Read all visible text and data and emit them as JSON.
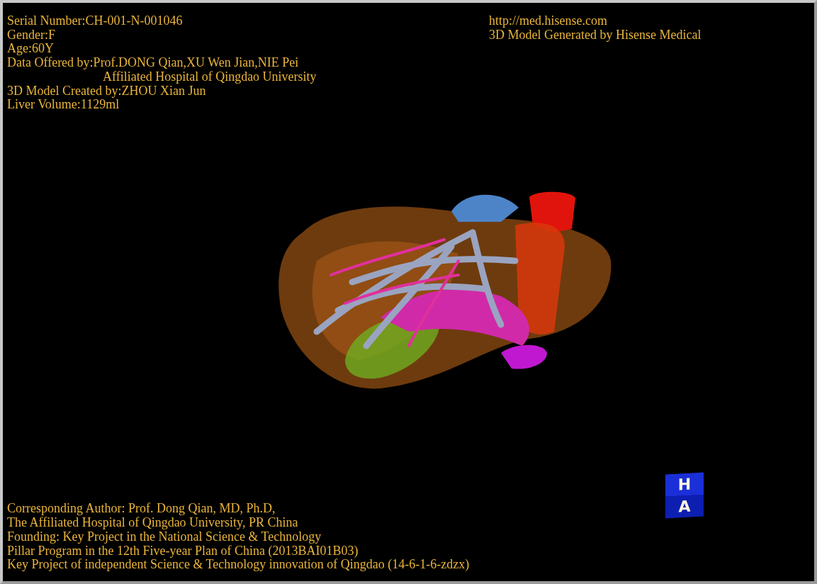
{
  "header_left": [
    {
      "kind": "plain",
      "text": "Serial Number:CH-001-N-001046"
    },
    {
      "kind": "plain",
      "text": "Gender:F"
    },
    {
      "kind": "plain",
      "text": "Age:60Y"
    },
    {
      "kind": "plain",
      "text": "Data Offered by:Prof.DONG Qian,XU Wen Jian,NIE Pei"
    },
    {
      "kind": "indented",
      "text": "Affiliated Hospital of Qingdao University"
    },
    {
      "kind": "plain",
      "text": "3D Model Created by:ZHOU Xian Jun"
    },
    {
      "kind": "plain",
      "text": "Liver Volume:1129ml"
    }
  ],
  "header_right": [
    "http://med.hisense.com",
    "3D Model Generated by Hisense Medical"
  ],
  "footer": [
    "Corresponding Author: Prof. Dong Qian, MD, Ph.D,",
    "The Affiliated Hospital of Qingdao University, PR China",
    "Founding: Key Project in the National Science & Technology",
    "Pillar Program in the 12th Five-year Plan of China (2013BAI01B03)",
    "Key Project of independent Science & Technology innovation of Qingdao (14-6-1-6-zdzx)"
  ],
  "orientation_cube": {
    "top": "H",
    "front": "A"
  }
}
